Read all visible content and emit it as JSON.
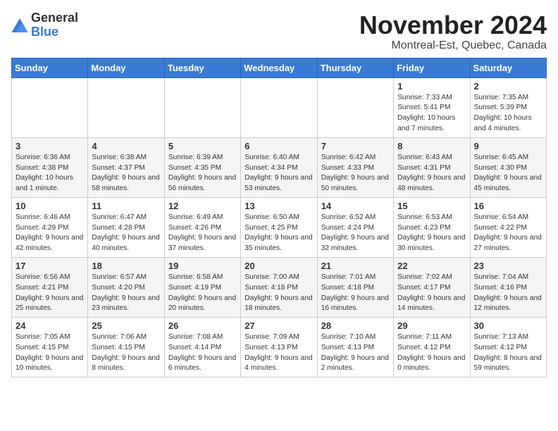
{
  "header": {
    "logo_general": "General",
    "logo_blue": "Blue",
    "month_title": "November 2024",
    "location": "Montreal-Est, Quebec, Canada"
  },
  "days_of_week": [
    "Sunday",
    "Monday",
    "Tuesday",
    "Wednesday",
    "Thursday",
    "Friday",
    "Saturday"
  ],
  "weeks": [
    [
      {
        "day": "",
        "info": ""
      },
      {
        "day": "",
        "info": ""
      },
      {
        "day": "",
        "info": ""
      },
      {
        "day": "",
        "info": ""
      },
      {
        "day": "",
        "info": ""
      },
      {
        "day": "1",
        "info": "Sunrise: 7:33 AM\nSunset: 5:41 PM\nDaylight: 10 hours and 7 minutes."
      },
      {
        "day": "2",
        "info": "Sunrise: 7:35 AM\nSunset: 5:39 PM\nDaylight: 10 hours and 4 minutes."
      }
    ],
    [
      {
        "day": "3",
        "info": "Sunrise: 6:36 AM\nSunset: 4:38 PM\nDaylight: 10 hours and 1 minute."
      },
      {
        "day": "4",
        "info": "Sunrise: 6:38 AM\nSunset: 4:37 PM\nDaylight: 9 hours and 58 minutes."
      },
      {
        "day": "5",
        "info": "Sunrise: 6:39 AM\nSunset: 4:35 PM\nDaylight: 9 hours and 56 minutes."
      },
      {
        "day": "6",
        "info": "Sunrise: 6:40 AM\nSunset: 4:34 PM\nDaylight: 9 hours and 53 minutes."
      },
      {
        "day": "7",
        "info": "Sunrise: 6:42 AM\nSunset: 4:33 PM\nDaylight: 9 hours and 50 minutes."
      },
      {
        "day": "8",
        "info": "Sunrise: 6:43 AM\nSunset: 4:31 PM\nDaylight: 9 hours and 48 minutes."
      },
      {
        "day": "9",
        "info": "Sunrise: 6:45 AM\nSunset: 4:30 PM\nDaylight: 9 hours and 45 minutes."
      }
    ],
    [
      {
        "day": "10",
        "info": "Sunrise: 6:46 AM\nSunset: 4:29 PM\nDaylight: 9 hours and 42 minutes."
      },
      {
        "day": "11",
        "info": "Sunrise: 6:47 AM\nSunset: 4:28 PM\nDaylight: 9 hours and 40 minutes."
      },
      {
        "day": "12",
        "info": "Sunrise: 6:49 AM\nSunset: 4:26 PM\nDaylight: 9 hours and 37 minutes."
      },
      {
        "day": "13",
        "info": "Sunrise: 6:50 AM\nSunset: 4:25 PM\nDaylight: 9 hours and 35 minutes."
      },
      {
        "day": "14",
        "info": "Sunrise: 6:52 AM\nSunset: 4:24 PM\nDaylight: 9 hours and 32 minutes."
      },
      {
        "day": "15",
        "info": "Sunrise: 6:53 AM\nSunset: 4:23 PM\nDaylight: 9 hours and 30 minutes."
      },
      {
        "day": "16",
        "info": "Sunrise: 6:54 AM\nSunset: 4:22 PM\nDaylight: 9 hours and 27 minutes."
      }
    ],
    [
      {
        "day": "17",
        "info": "Sunrise: 6:56 AM\nSunset: 4:21 PM\nDaylight: 9 hours and 25 minutes."
      },
      {
        "day": "18",
        "info": "Sunrise: 6:57 AM\nSunset: 4:20 PM\nDaylight: 9 hours and 23 minutes."
      },
      {
        "day": "19",
        "info": "Sunrise: 6:58 AM\nSunset: 4:19 PM\nDaylight: 9 hours and 20 minutes."
      },
      {
        "day": "20",
        "info": "Sunrise: 7:00 AM\nSunset: 4:18 PM\nDaylight: 9 hours and 18 minutes."
      },
      {
        "day": "21",
        "info": "Sunrise: 7:01 AM\nSunset: 4:18 PM\nDaylight: 9 hours and 16 minutes."
      },
      {
        "day": "22",
        "info": "Sunrise: 7:02 AM\nSunset: 4:17 PM\nDaylight: 9 hours and 14 minutes."
      },
      {
        "day": "23",
        "info": "Sunrise: 7:04 AM\nSunset: 4:16 PM\nDaylight: 9 hours and 12 minutes."
      }
    ],
    [
      {
        "day": "24",
        "info": "Sunrise: 7:05 AM\nSunset: 4:15 PM\nDaylight: 9 hours and 10 minutes."
      },
      {
        "day": "25",
        "info": "Sunrise: 7:06 AM\nSunset: 4:15 PM\nDaylight: 9 hours and 8 minutes."
      },
      {
        "day": "26",
        "info": "Sunrise: 7:08 AM\nSunset: 4:14 PM\nDaylight: 9 hours and 6 minutes."
      },
      {
        "day": "27",
        "info": "Sunrise: 7:09 AM\nSunset: 4:13 PM\nDaylight: 9 hours and 4 minutes."
      },
      {
        "day": "28",
        "info": "Sunrise: 7:10 AM\nSunset: 4:13 PM\nDaylight: 9 hours and 2 minutes."
      },
      {
        "day": "29",
        "info": "Sunrise: 7:11 AM\nSunset: 4:12 PM\nDaylight: 9 hours and 0 minutes."
      },
      {
        "day": "30",
        "info": "Sunrise: 7:13 AM\nSunset: 4:12 PM\nDaylight: 8 hours and 59 minutes."
      }
    ]
  ]
}
